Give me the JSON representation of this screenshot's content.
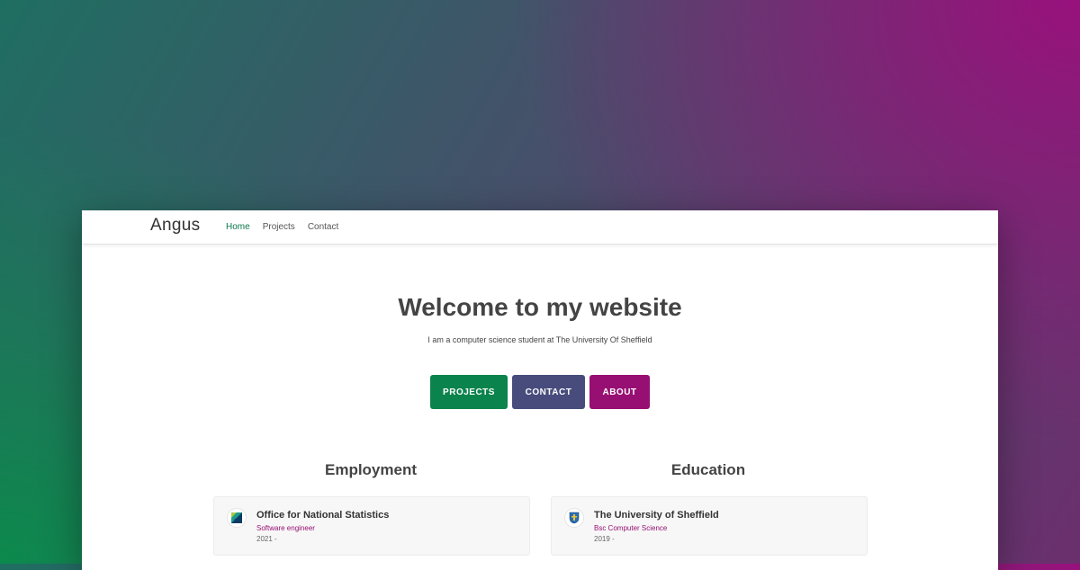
{
  "nav": {
    "brand": "Angus",
    "links": [
      {
        "label": "Home",
        "active": true
      },
      {
        "label": "Projects",
        "active": false
      },
      {
        "label": "Contact",
        "active": false
      }
    ]
  },
  "hero": {
    "title": "Welcome to my website",
    "subtitle": "I am a computer science student at The University Of Sheffield"
  },
  "buttons": {
    "projects": "PROJECTS",
    "contact": "CONTACT",
    "about": "ABOUT"
  },
  "employment": {
    "title": "Employment",
    "items": [
      {
        "org": "Office for National Statistics",
        "role": "Software engineer",
        "years": "2021 -",
        "logo_icon": "ons-logo-icon"
      }
    ]
  },
  "education": {
    "title": "Education",
    "items": [
      {
        "org": "The University of Sheffield",
        "role": "Bsc Computer Science",
        "years": "2019 -",
        "logo_icon": "university-crest-icon"
      }
    ]
  },
  "colors": {
    "green": "#0b834c",
    "slate": "#474c7c",
    "magenta": "#970f72"
  }
}
